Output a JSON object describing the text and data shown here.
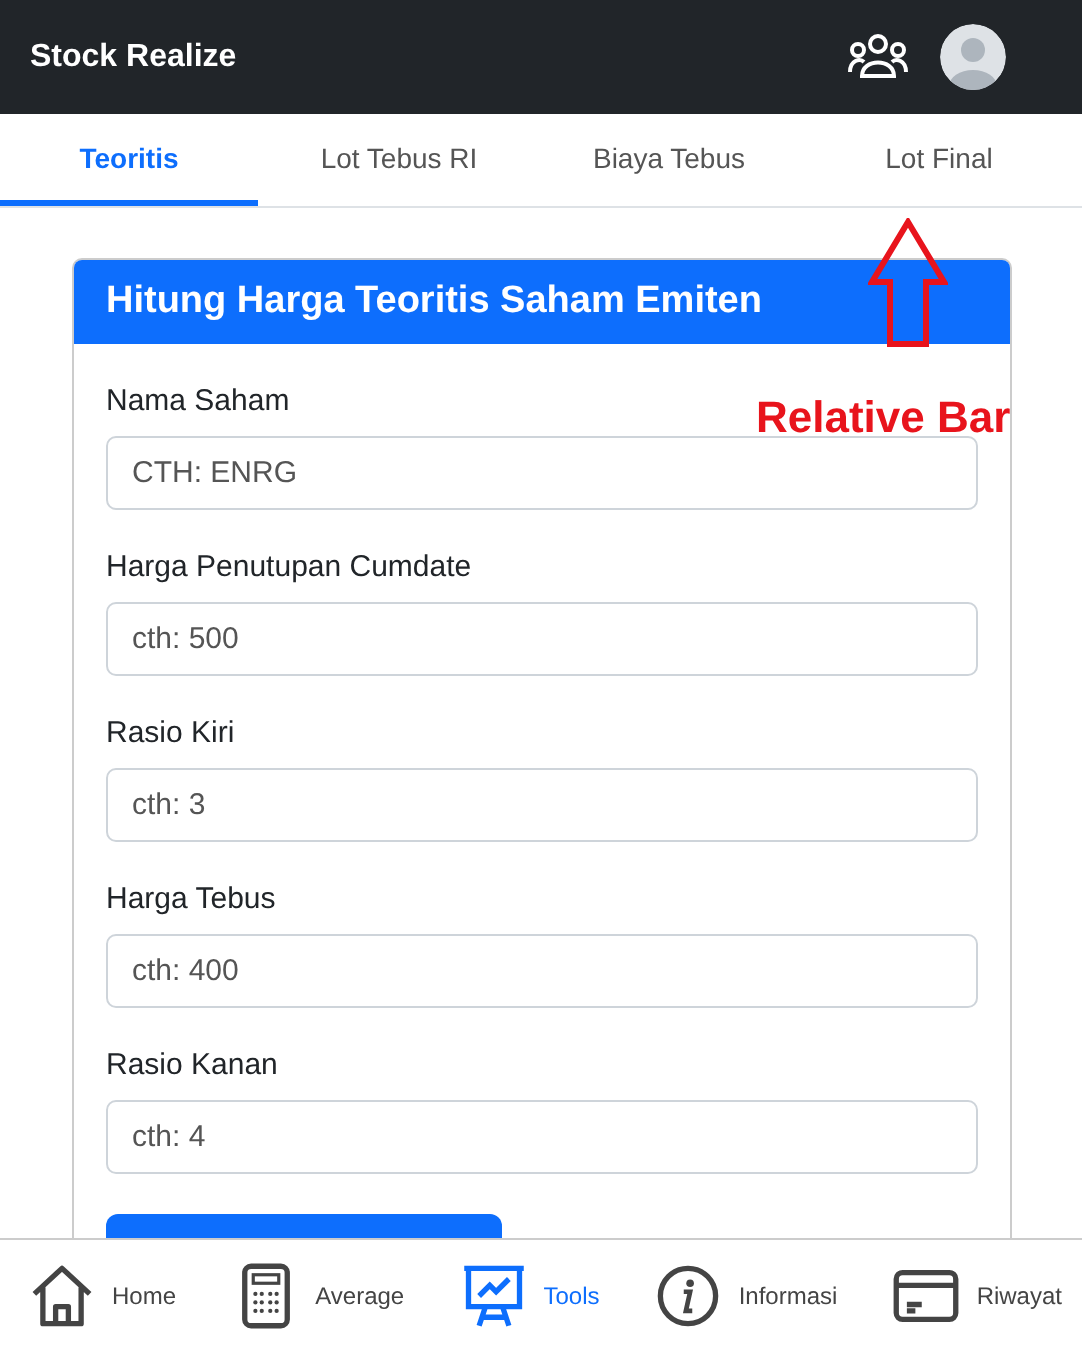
{
  "header": {
    "title": "Stock Realize"
  },
  "tabs": [
    {
      "label": "Teoritis",
      "selected": true
    },
    {
      "label": "Lot Tebus RI",
      "selected": false
    },
    {
      "label": "Biaya Tebus",
      "selected": false
    },
    {
      "label": "Lot Final",
      "selected": false
    }
  ],
  "card": {
    "title": "Hitung Harga Teoritis Saham Emiten",
    "fields": [
      {
        "label": "Nama Saham",
        "placeholder": "CTH: ENRG"
      },
      {
        "label": "Harga Penutupan Cumdate",
        "placeholder": "cth: 500"
      },
      {
        "label": "Rasio Kiri",
        "placeholder": "cth: 3"
      },
      {
        "label": "Harga Tebus",
        "placeholder": "cth: 400"
      },
      {
        "label": "Rasio Kanan",
        "placeholder": "cth: 4"
      }
    ]
  },
  "annotation": {
    "text": "Relative Bar"
  },
  "bottom_nav": [
    {
      "label": "Home",
      "kind": "home",
      "selected": false
    },
    {
      "label": "Average",
      "kind": "calculator",
      "selected": false
    },
    {
      "label": "Tools",
      "kind": "chart",
      "selected": true
    },
    {
      "label": "Informasi",
      "kind": "info",
      "selected": false
    },
    {
      "label": "Riwayat",
      "kind": "card",
      "selected": false
    }
  ]
}
